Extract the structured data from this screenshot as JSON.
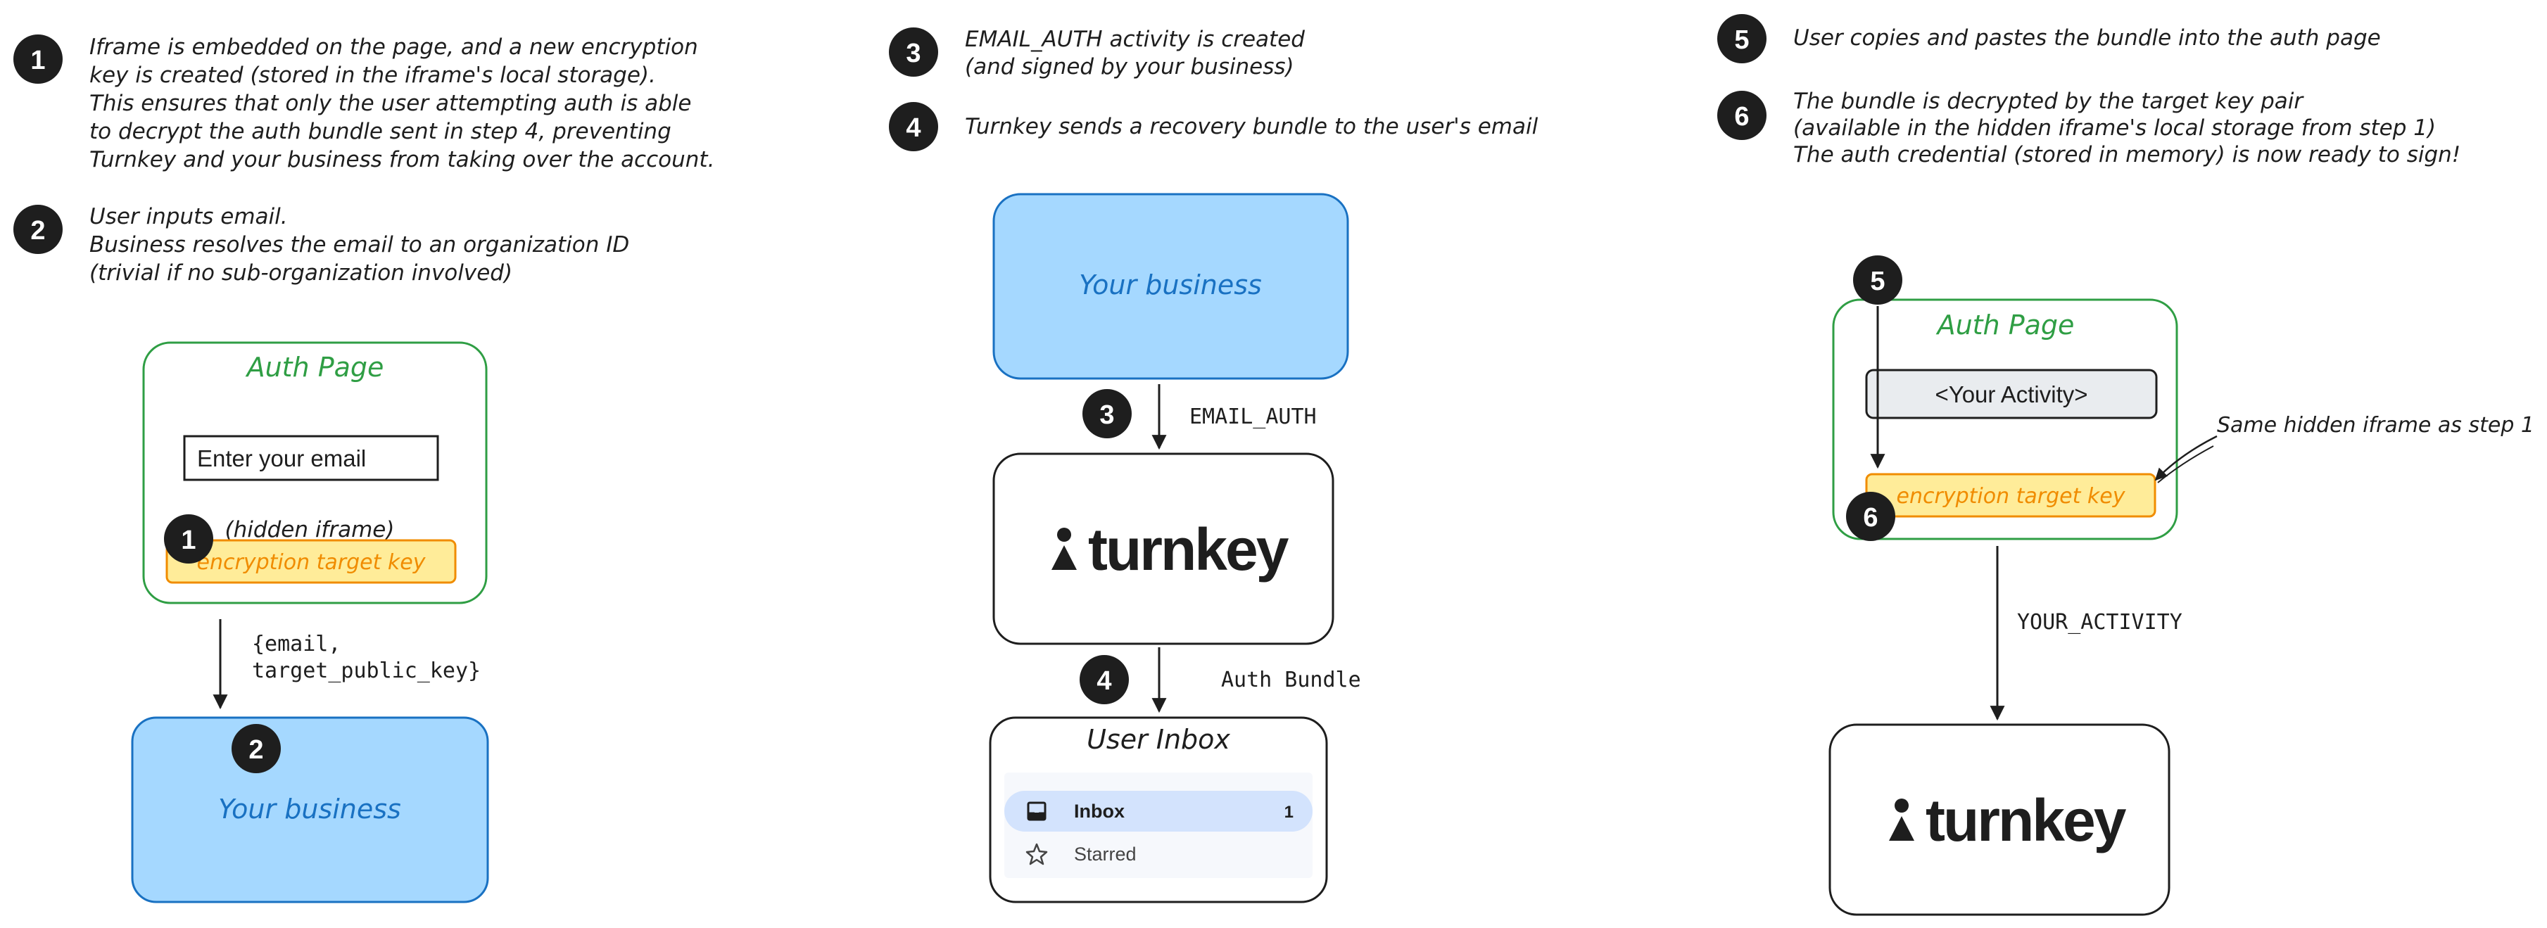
{
  "colors": {
    "ink": "#1e1e1e",
    "green": "#2f9e44",
    "blue_fill": "#a5d8ff",
    "blue_stroke": "#1971c2",
    "blue_text": "#1971c2",
    "key_fill": "#ffec99",
    "key_stroke": "#f08c00",
    "key_text": "#f08c00",
    "inbox_active": "#d3e3fd",
    "activity_fill": "#e9ecef"
  },
  "steps": {
    "s1": {
      "number": "1",
      "lines": [
        "Iframe is embedded on the page, and a new encryption",
        "key is created (stored in the iframe's local storage).",
        "This ensures that only the user attempting auth is able",
        "to decrypt the auth bundle sent in step 4, preventing",
        "Turnkey and your business from taking over the account."
      ]
    },
    "s2": {
      "number": "2",
      "lines": [
        "User inputs email.",
        "Business resolves the email to an organization ID",
        "(trivial if no sub-organization involved)"
      ]
    },
    "s3": {
      "number": "3",
      "lines": [
        "EMAIL_AUTH activity is created",
        "(and signed by your business)"
      ]
    },
    "s4": {
      "number": "4",
      "lines": [
        "Turnkey sends a recovery bundle to the user's email"
      ]
    },
    "s5": {
      "number": "5",
      "lines": [
        "User copies and pastes the bundle into the auth page"
      ]
    },
    "s6": {
      "number": "6",
      "lines": [
        "The bundle is decrypted by the target key pair",
        "(available in the hidden iframe's local storage from step 1)",
        "The auth credential (stored in memory) is now ready to sign!"
      ]
    }
  },
  "col1": {
    "auth_title": "Auth Page",
    "email_placeholder": "Enter your email",
    "hidden_iframe": "(hidden iframe)",
    "encryption_key": "encryption target key",
    "arrow_label_1": "{email,",
    "arrow_label_2": "target_public_key}",
    "business": "Your business"
  },
  "col2": {
    "business": "Your business",
    "arrow_label_1": "EMAIL_AUTH",
    "turnkey": "turnkey",
    "arrow_label_2": "Auth Bundle",
    "inbox_title": "User Inbox",
    "inbox_label": "Inbox",
    "inbox_count": "1",
    "starred_label": "Starred"
  },
  "col3": {
    "auth_title": "Auth Page",
    "activity": "<Your Activity>",
    "encryption_key": "encryption target key",
    "annotation": "Same hidden iframe as step 1",
    "arrow_label": "YOUR_ACTIVITY",
    "turnkey": "turnkey"
  },
  "icons": {
    "turnkey_logo": "turnkey-figure-icon",
    "inbox": "inbox-tray-icon",
    "starred": "star-outline-icon"
  }
}
